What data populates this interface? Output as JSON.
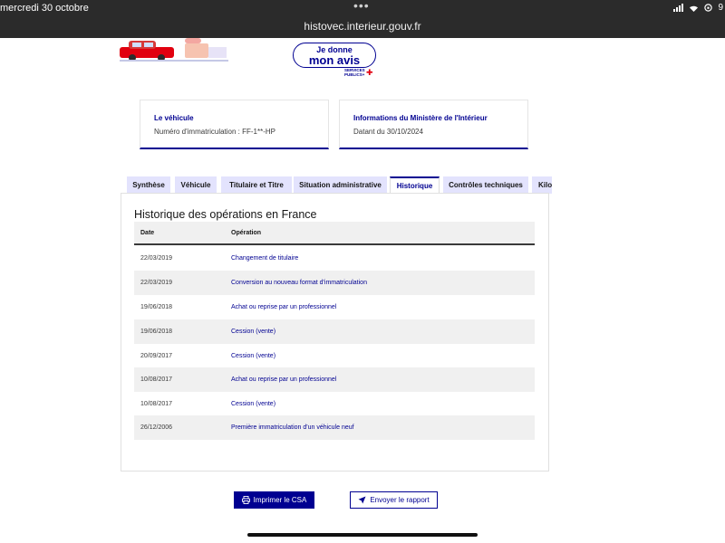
{
  "status_bar": {
    "time_date": "mercredi 30 octobre",
    "battery": "9",
    "url": "histovec.interieur.gouv.fr",
    "menu_dots": "•••"
  },
  "avis_badge": {
    "line1": "Je donne",
    "line2": "mon avis",
    "sub1": "SERVICES",
    "sub2": "PUBLICS+"
  },
  "cards": [
    {
      "title": "Le véhicule",
      "value": "Numéro d'immatriculation : FF-1**-HP"
    },
    {
      "title": "Informations du Ministère de l'Intérieur",
      "value": "Datant du 30/10/2024"
    }
  ],
  "tabs": [
    {
      "label": "Synthèse",
      "active": false
    },
    {
      "label": "Véhicule",
      "active": false
    },
    {
      "label": "Titulaire et Titre",
      "active": false
    },
    {
      "label": "Situation administrative",
      "active": false
    },
    {
      "label": "Historique",
      "active": true
    },
    {
      "label": "Contrôles techniques",
      "active": false
    },
    {
      "label": "Kilo",
      "active": false
    }
  ],
  "history": {
    "title": "Historique des opérations en France",
    "headers": {
      "date": "Date",
      "operation": "Opération"
    },
    "rows": [
      {
        "date": "22/03/2019",
        "operation": "Changement de titulaire"
      },
      {
        "date": "22/03/2019",
        "operation": "Conversion au nouveau format d'immatriculation"
      },
      {
        "date": "19/06/2018",
        "operation": "Achat ou reprise par un professionnel"
      },
      {
        "date": "19/06/2018",
        "operation": "Cession (vente)"
      },
      {
        "date": "20/09/2017",
        "operation": "Cession (vente)"
      },
      {
        "date": "10/08/2017",
        "operation": "Achat ou reprise par un professionnel"
      },
      {
        "date": "10/08/2017",
        "operation": "Cession (vente)"
      },
      {
        "date": "26/12/2006",
        "operation": "Première immatriculation d'un véhicule neuf"
      }
    ]
  },
  "actions": {
    "print": "Imprimer le CSA",
    "send": "Envoyer le rapport"
  },
  "colors": {
    "primary": "#000091",
    "tab_bg": "#e3e3fd",
    "row_alt": "#f0f0f0",
    "topbar": "#2b2b2b"
  }
}
